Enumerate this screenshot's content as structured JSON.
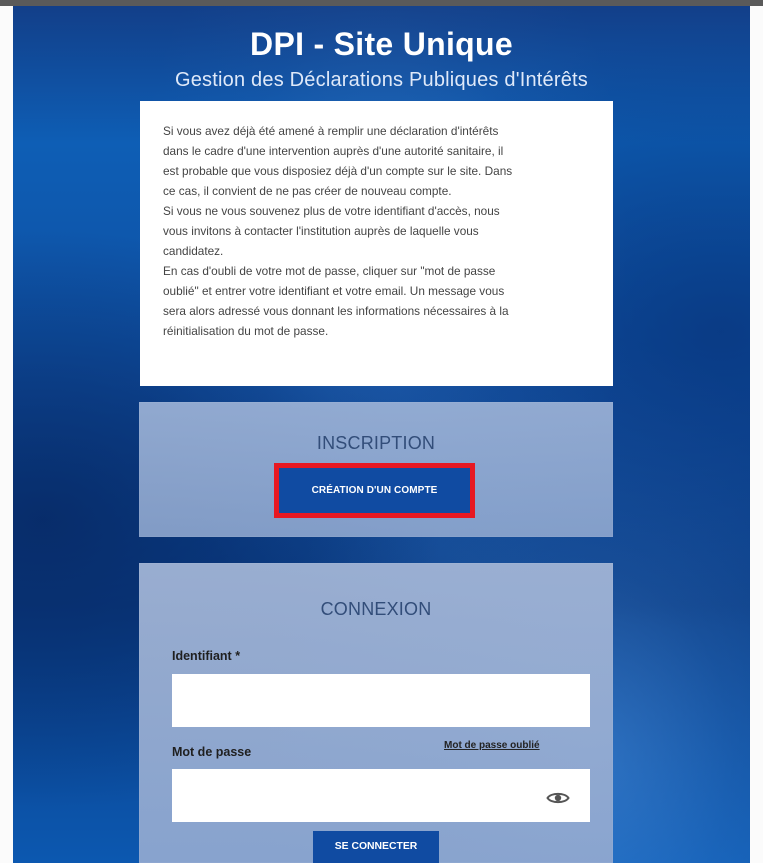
{
  "header": {
    "title": "DPI - Site Unique",
    "subtitle": "Gestion des Déclarations Publiques d'Intérêts"
  },
  "info": {
    "lines": [
      "Si vous avez déjà été amené à remplir une déclaration d'intérêts",
      "dans le cadre d'une intervention auprès d'une autorité sanitaire, il",
      "est probable que vous disposiez déjà d'un compte sur le site. Dans",
      "ce cas, il convient de ne pas créer de nouveau compte.",
      "Si vous ne vous souvenez plus de votre identifiant d'accès, nous",
      "vous invitons à contacter l'institution auprès de laquelle vous",
      "candidatez.",
      "En cas d'oubli de votre mot de passe, cliquer sur \"mot de passe",
      "oublié\" et entrer votre identifiant et votre email. Un message vous",
      "sera alors adressé vous donnant les informations nécessaires à la",
      "réinitialisation du mot de passe."
    ]
  },
  "inscription": {
    "title": "INSCRIPTION",
    "button_label": "CRÉATION D'UN COMPTE",
    "highlight_color": "#e71822"
  },
  "connexion": {
    "title": "CONNEXION",
    "identifiant_label": "Identifiant *",
    "identifiant_value": "",
    "identifiant_placeholder": "",
    "password_label": "Mot de passe",
    "password_value": "",
    "password_placeholder": "",
    "forgot_link": "Mot de passe oublié",
    "eye_icon": "eye-icon",
    "login_label": "SE CONNECTER"
  },
  "colors": {
    "primary_button": "#104ba2",
    "background_blue": "#0f4d9f",
    "panel_blue": "#97afd6"
  }
}
